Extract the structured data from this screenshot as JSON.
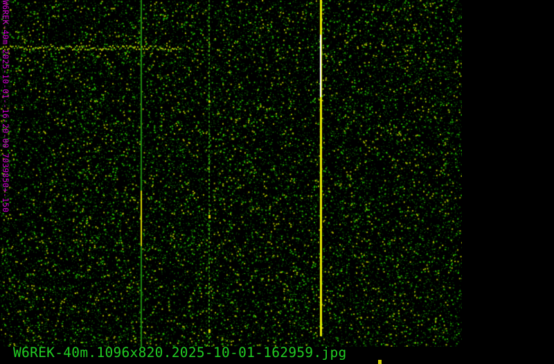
{
  "waterfall": {
    "vertical_label": "W6REK-40m 2025-10-01--16-20-00 7039850+-150",
    "filename": "W6REK-40m.1096x820.2025-10-01-162959.jpg",
    "colors": {
      "background": "#000000",
      "noise": "#2f9e10",
      "signal": "#e0e000",
      "label": "#d000d0",
      "caption": "#22cc22"
    }
  }
}
